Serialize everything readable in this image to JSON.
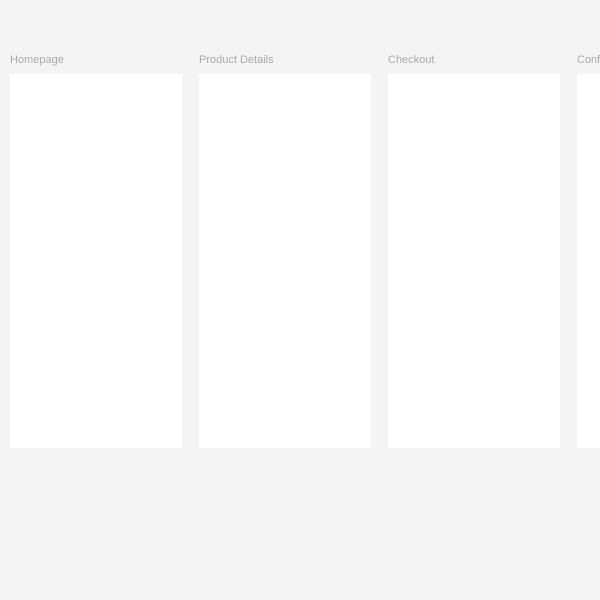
{
  "canvas": {
    "background": "#f4f4f4",
    "frames": [
      {
        "label": "Homepage"
      },
      {
        "label": "Product Details"
      },
      {
        "label": "Checkout"
      },
      {
        "label": "Conf"
      }
    ]
  }
}
